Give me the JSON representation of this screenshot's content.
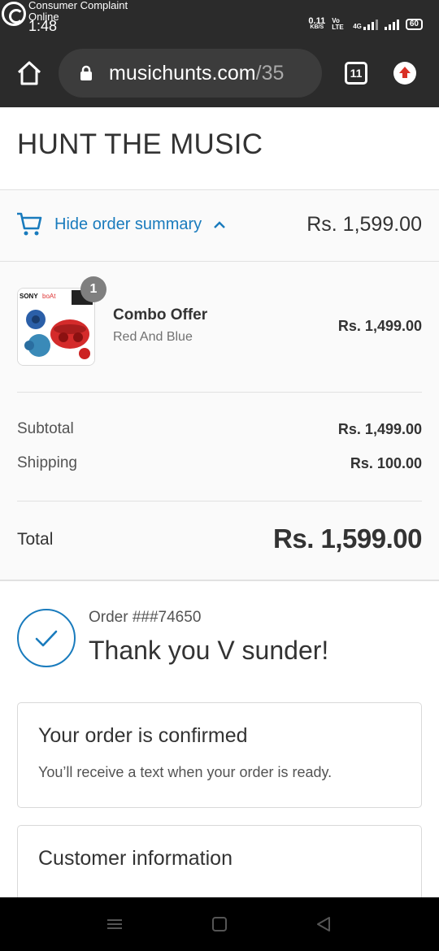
{
  "status_bar": {
    "notification": "Consumer Complaint Online",
    "time": "1:48",
    "net_speed": "0.11",
    "net_unit": "KB/S",
    "volte": "Vo LTE",
    "network": "4G",
    "battery": "60"
  },
  "browser": {
    "url_host": "musichunts.com",
    "url_rest": "/35",
    "tab_count": "11"
  },
  "store": {
    "title": "HUNT THE MUSIC"
  },
  "summary_toggle": {
    "label": "Hide order summary",
    "total": "Rs. 1,599.00",
    "accent": "#197bbd"
  },
  "order": {
    "item": {
      "quantity": "1",
      "name": "Combo Offer",
      "variant": "Red And Blue",
      "price": "Rs. 1,499.00",
      "thumb_brand_1": "SONY",
      "thumb_brand_2": "boAt"
    },
    "subtotal_label": "Subtotal",
    "subtotal_value": "Rs. 1,499.00",
    "shipping_label": "Shipping",
    "shipping_value": "Rs. 100.00",
    "total_label": "Total",
    "total_value": "Rs. 1,599.00"
  },
  "confirmation": {
    "order_number": "Order ###74650",
    "thank_you": "Thank you V sunder!",
    "confirmed_title": "Your order is confirmed",
    "confirmed_text": "You’ll receive a text when your order is ready.",
    "customer_info_title": "Customer information"
  }
}
